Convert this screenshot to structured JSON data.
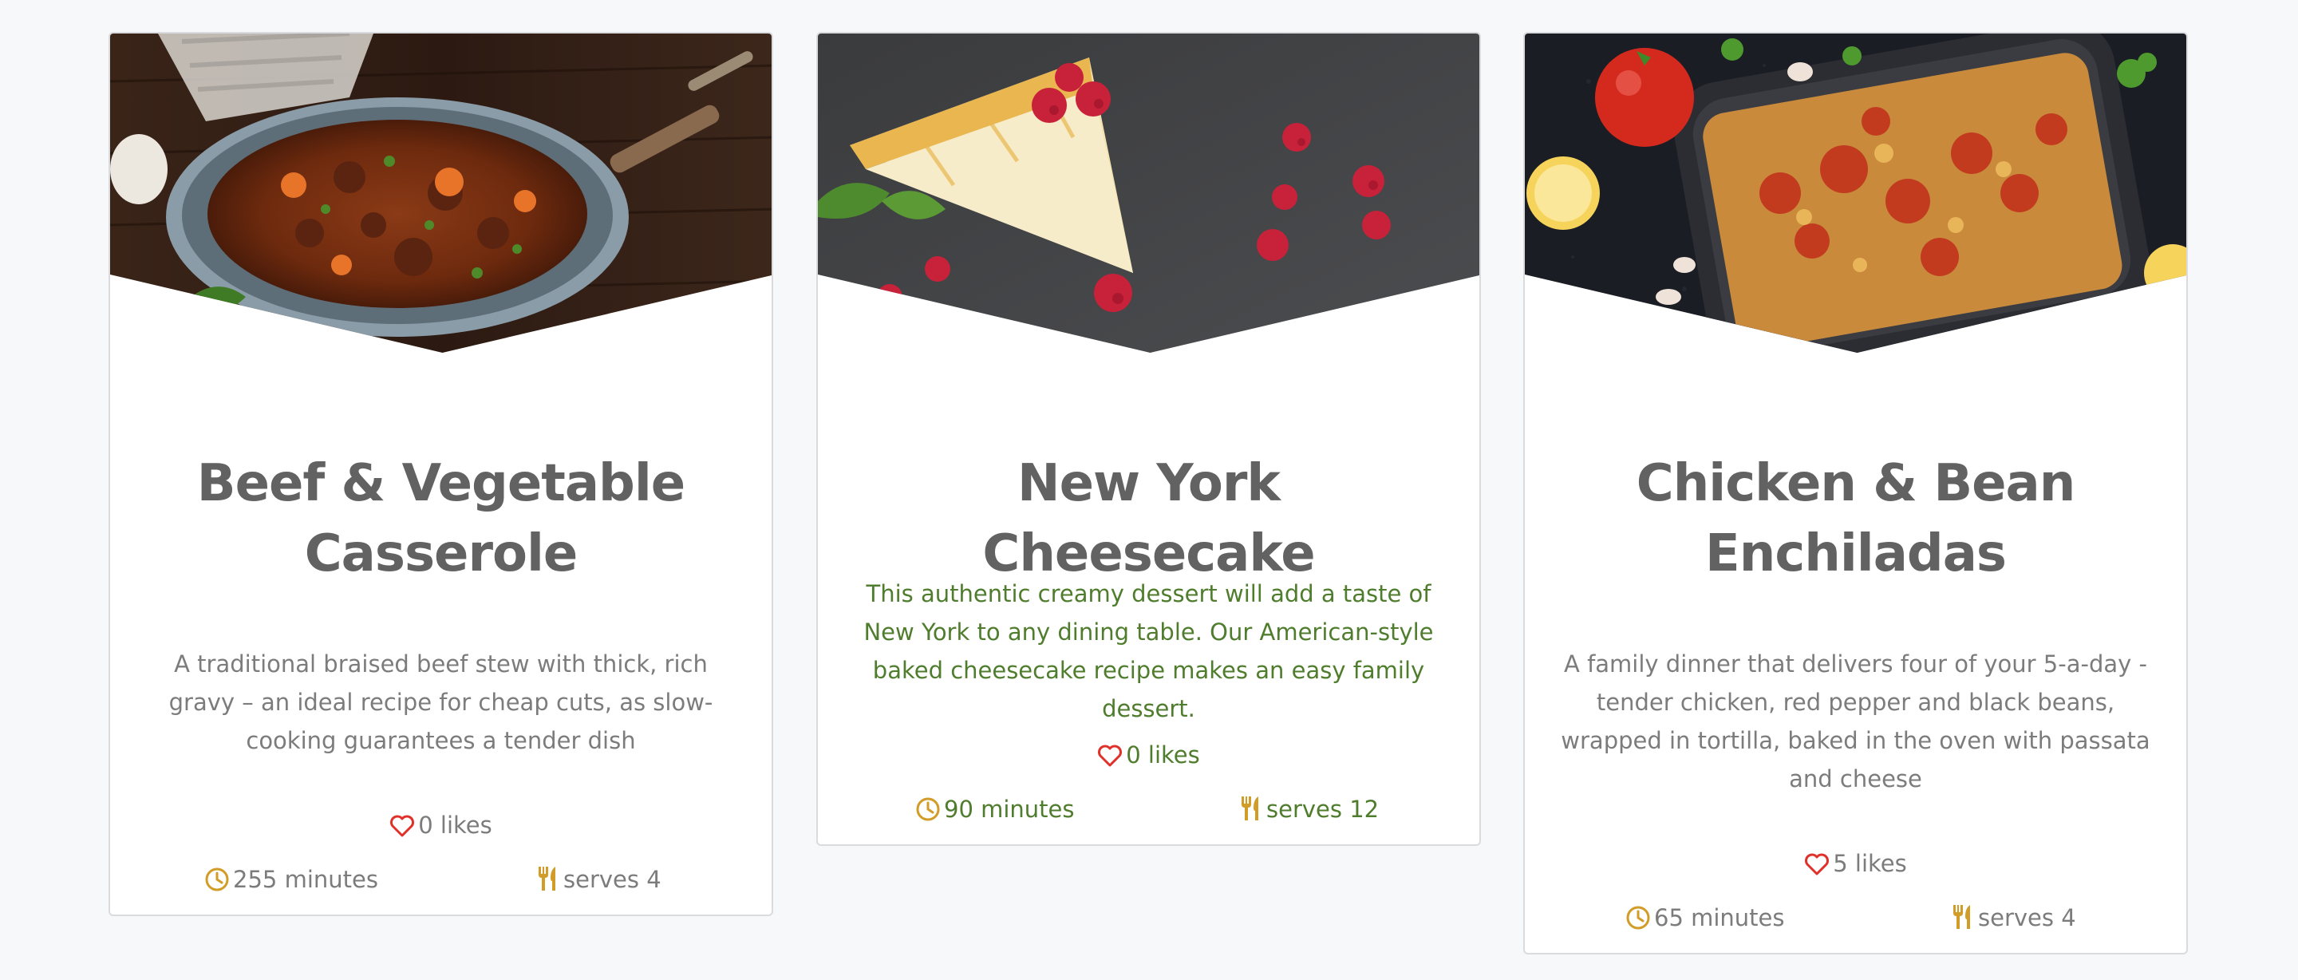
{
  "colors": {
    "accent_gold": "#d29c28",
    "heart_red": "#e0302a",
    "title_gray": "#626262",
    "text_gray": "#7c7c7c",
    "highlight_green": "#4f7d2d",
    "card_border": "#d9dbdf",
    "page_background": "#f7f8fa"
  },
  "recipes": [
    {
      "image": "beef-vegetable-casserole-photo",
      "title": "Beef & Vegetable Casserole",
      "description": "A traditional braised beef stew with thick, rich gravy – an ideal recipe for cheap cuts, as slow-cooking guarantees a tender dish",
      "likes": "0 likes",
      "time": "255 minutes",
      "serves": "serves 4"
    },
    {
      "image": "new-york-cheesecake-photo",
      "title": "New York Cheesecake",
      "description": "This authentic creamy dessert will add a taste of New York to any dining table. Our American-style baked cheesecake recipe makes an easy family dessert.",
      "likes": "0 likes",
      "time": "90 minutes",
      "serves": "serves 12",
      "highlighted": true
    },
    {
      "image": "chicken-bean-enchiladas-photo",
      "title": "Chicken & Bean Enchiladas",
      "description": "A family dinner that delivers four of your 5-a-day - tender chicken, red pepper and black beans, wrapped in tortilla, baked in the oven with passata and cheese",
      "likes": "5 likes",
      "time": "65 minutes",
      "serves": "serves 4"
    }
  ],
  "icons": {
    "likes": "heart-outline-icon",
    "time": "clock-icon",
    "serves": "fork-knife-icon"
  }
}
